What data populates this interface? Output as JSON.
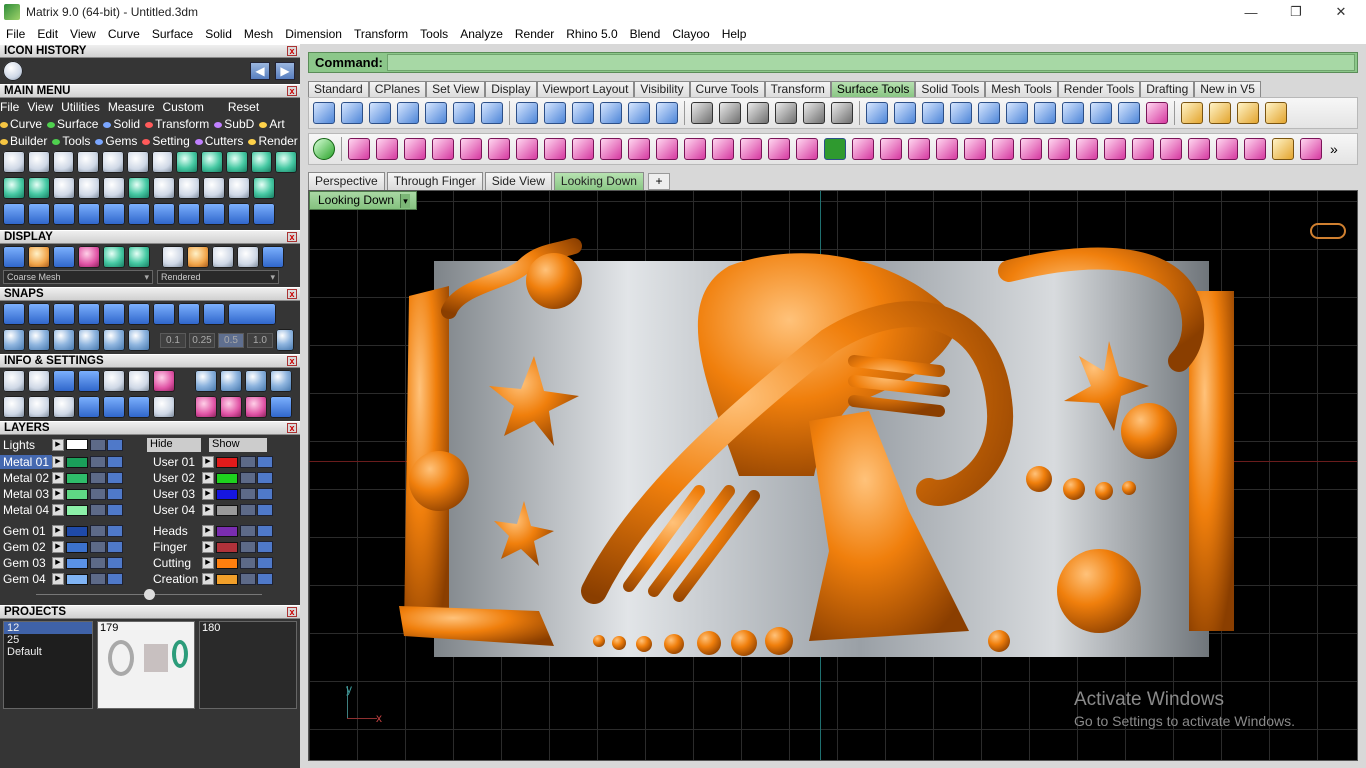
{
  "window": {
    "title": "Matrix 9.0 (64-bit) - Untitled.3dm",
    "minimize": "—",
    "maximize": "❐",
    "close": "✕"
  },
  "menubar": {
    "items": [
      "File",
      "Edit",
      "View",
      "Curve",
      "Surface",
      "Solid",
      "Mesh",
      "Dimension",
      "Transform",
      "Tools",
      "Analyze",
      "Render",
      "Rhino 5.0",
      "Blend",
      "Clayoo",
      "Help"
    ]
  },
  "panels": {
    "icon_history": {
      "title": "ICON HISTORY",
      "back": "◀",
      "forward": "▶"
    },
    "main_menu": {
      "title": "MAIN MENU",
      "row1": [
        "File",
        "View",
        "Utilities",
        "Measure",
        "Custom"
      ],
      "reset": "Reset",
      "row2": [
        "Curve",
        "Surface",
        "Solid",
        "Transform",
        "SubD",
        "Art"
      ],
      "row3": [
        "Builder",
        "Tools",
        "Gems",
        "Setting",
        "Cutters",
        "Render"
      ]
    },
    "display": {
      "title": "DISPLAY",
      "mesh_mode": "Coarse Mesh",
      "render_mode": "Rendered"
    },
    "snaps": {
      "title": "SNAPS",
      "values": [
        "0.1",
        "0.25",
        "0.5",
        "1.0"
      ]
    },
    "info": {
      "title": "INFO & SETTINGS"
    },
    "layers": {
      "title": "LAYERS",
      "lights": "Lights",
      "hide": "Hide",
      "show": "Show",
      "left": [
        {
          "name": "Metal 01",
          "color": "#1aa05a",
          "selected": true
        },
        {
          "name": "Metal 02",
          "color": "#2fbd6a"
        },
        {
          "name": "Metal 03",
          "color": "#5fd884"
        },
        {
          "name": "Metal 04",
          "color": "#8cf0a8"
        },
        {
          "name": "Gem 01",
          "color": "#1f4aa8"
        },
        {
          "name": "Gem 02",
          "color": "#3c72cc"
        },
        {
          "name": "Gem 03",
          "color": "#5a92e6"
        },
        {
          "name": "Gem 04",
          "color": "#80b4f4"
        }
      ],
      "right": [
        {
          "name": "User 01",
          "color": "#e21b1b"
        },
        {
          "name": "User 02",
          "color": "#1ed21e"
        },
        {
          "name": "User 03",
          "color": "#1616e0"
        },
        {
          "name": "User 04",
          "color": "#9a9a9a"
        },
        {
          "name": "Heads",
          "color": "#7a2db0"
        },
        {
          "name": "Finger",
          "color": "#b0323a"
        },
        {
          "name": "Cutting",
          "color": "#ff7f0e"
        },
        {
          "name": "Creation",
          "color": "#f2a02a"
        }
      ]
    },
    "projects": {
      "title": "PROJECTS",
      "list": [
        "12",
        "25",
        "Default"
      ],
      "thumbs": [
        "179",
        "180"
      ]
    }
  },
  "command": {
    "label": "Command:",
    "value": ""
  },
  "toolbar_tabs": [
    "Standard",
    "CPlanes",
    "Set View",
    "Display",
    "Viewport Layout",
    "Visibility",
    "Curve Tools",
    "Transform",
    "Surface Tools",
    "Solid Tools",
    "Mesh Tools",
    "Render Tools",
    "Drafting",
    "New in V5"
  ],
  "active_toolbar_tab": "Surface Tools",
  "viewport_tabs": [
    "Perspective",
    "Through Finger",
    "Side View",
    "Looking Down"
  ],
  "active_viewport_tab": "Looking Down",
  "add_viewport": "+",
  "viewport": {
    "label": "Looking Down",
    "axis_x": "x",
    "axis_y": "y"
  },
  "watermark": {
    "title": "Activate Windows",
    "subtitle": "Go to Settings to activate Windows."
  },
  "colors": {
    "accent_green": "#8cc78a",
    "model_orange": "#f07f0c",
    "model_silver": "#b9bdc2"
  }
}
